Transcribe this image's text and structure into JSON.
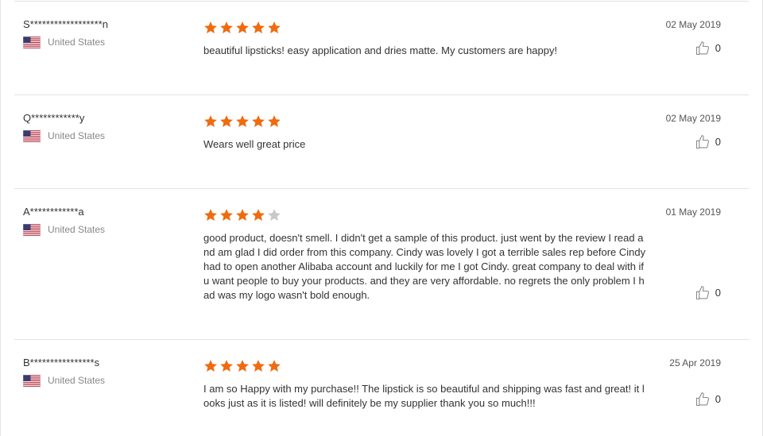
{
  "colors": {
    "star_filled": "#F06B0F",
    "star_empty": "#C8C8C8",
    "divider": "#E2E2E2"
  },
  "reviews": [
    {
      "reviewer": "S******************n",
      "country": "United States",
      "flag_icon": "us-flag-icon",
      "rating": 5,
      "text": "beautiful lipsticks! easy application and dries matte. My customers are happy!",
      "date": "02 May 2019",
      "likes": "0"
    },
    {
      "reviewer": "Q************y",
      "country": "United States",
      "flag_icon": "us-flag-icon",
      "rating": 5,
      "text": "Wears well great price",
      "date": "02 May 2019",
      "likes": "0"
    },
    {
      "reviewer": "A************a",
      "country": "United States",
      "flag_icon": "us-flag-icon",
      "rating": 4,
      "text": "good product, doesn't smell. I didn't get a sample of this product. just went by the review I read and am glad I did order from this company. Cindy was lovely I got a terrible sales rep before Cindy had to open another Alibaba account and luckily for me I got Cindy. great company to deal with if u want people to buy your products. and they are very affordable. no regrets the only problem I had was my logo wasn't bold enough.",
      "date": "01 May 2019",
      "likes": "0"
    },
    {
      "reviewer": "B****************s",
      "country": "United States",
      "flag_icon": "us-flag-icon",
      "rating": 5,
      "text": "I am so Happy with my purchase!! The lipstick is so  beautiful and shipping was fast and great! it looks just as it is listed! will definitely be my supplier thank you so much!!!",
      "date": "25 Apr 2019",
      "likes": "0"
    }
  ]
}
